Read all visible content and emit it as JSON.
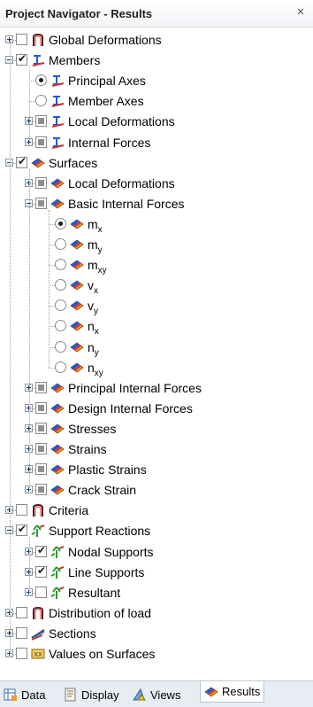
{
  "window": {
    "title": "Project Navigator - Results",
    "close_glyph": "×"
  },
  "tree": [
    {
      "key": "global_deformations",
      "label": "Global Deformations",
      "icon": "deformation-icon",
      "state": "unchecked",
      "expander": "plus"
    },
    {
      "key": "members",
      "label": "Members",
      "icon": "member-icon",
      "state": "checked",
      "expander": "minus"
    },
    {
      "key": "principal_axes",
      "label": "Principal Axes",
      "icon": "member-icon",
      "state": "radio-on"
    },
    {
      "key": "member_axes",
      "label": "Member Axes",
      "icon": "member-icon",
      "state": "radio-off"
    },
    {
      "key": "member_local_deformations",
      "label": "Local Deformations",
      "icon": "member-icon",
      "state": "partial",
      "expander": "plus"
    },
    {
      "key": "internal_forces",
      "label": "Internal Forces",
      "icon": "member-icon",
      "state": "partial",
      "expander": "plus"
    },
    {
      "key": "surfaces",
      "label": "Surfaces",
      "icon": "surface-icon",
      "state": "checked",
      "expander": "minus"
    },
    {
      "key": "surface_local_deformations",
      "label": "Local Deformations",
      "icon": "surface-icon",
      "state": "partial",
      "expander": "plus"
    },
    {
      "key": "basic_internal_forces",
      "label": "Basic Internal Forces",
      "icon": "surface-icon",
      "state": "partial",
      "expander": "minus"
    },
    {
      "key": "mx",
      "label": "m",
      "sub": "x",
      "icon": "surface-icon",
      "state": "radio-on"
    },
    {
      "key": "my",
      "label": "m",
      "sub": "y",
      "icon": "surface-icon",
      "state": "radio-off"
    },
    {
      "key": "mxy",
      "label": "m",
      "sub": "xy",
      "icon": "surface-icon",
      "state": "radio-off"
    },
    {
      "key": "vx",
      "label": "v",
      "sub": "x",
      "icon": "surface-icon",
      "state": "radio-off"
    },
    {
      "key": "vy",
      "label": "v",
      "sub": "y",
      "icon": "surface-icon",
      "state": "radio-off"
    },
    {
      "key": "nx",
      "label": "n",
      "sub": "x",
      "icon": "surface-icon",
      "state": "radio-off"
    },
    {
      "key": "ny",
      "label": "n",
      "sub": "y",
      "icon": "surface-icon",
      "state": "radio-off"
    },
    {
      "key": "nxy",
      "label": "n",
      "sub": "xy",
      "icon": "surface-icon",
      "state": "radio-off"
    },
    {
      "key": "principal_internal_forces",
      "label": "Principal Internal Forces",
      "icon": "surface-icon",
      "state": "partial",
      "expander": "plus"
    },
    {
      "key": "design_internal_forces",
      "label": "Design Internal Forces",
      "icon": "surface-icon",
      "state": "partial",
      "expander": "plus"
    },
    {
      "key": "stresses",
      "label": "Stresses",
      "icon": "surface-icon",
      "state": "partial",
      "expander": "plus"
    },
    {
      "key": "strains",
      "label": "Strains",
      "icon": "surface-icon",
      "state": "partial",
      "expander": "plus"
    },
    {
      "key": "plastic_strains",
      "label": "Plastic Strains",
      "icon": "surface-icon",
      "state": "partial",
      "expander": "plus"
    },
    {
      "key": "crack_strain",
      "label": "Crack Strain",
      "icon": "surface-icon",
      "state": "partial",
      "expander": "plus"
    },
    {
      "key": "criteria",
      "label": "Criteria",
      "icon": "deformation-icon",
      "state": "unchecked",
      "expander": "plus"
    },
    {
      "key": "support_reactions",
      "label": "Support Reactions",
      "icon": "support-icon",
      "state": "checked",
      "expander": "minus"
    },
    {
      "key": "nodal_supports",
      "label": "Nodal Supports",
      "icon": "support-icon",
      "state": "checked",
      "expander": "plus"
    },
    {
      "key": "line_supports",
      "label": "Line Supports",
      "icon": "support-icon",
      "state": "checked",
      "expander": "plus"
    },
    {
      "key": "resultant",
      "label": "Resultant",
      "icon": "support-icon",
      "state": "unchecked",
      "expander": "plus"
    },
    {
      "key": "distribution_of_load",
      "label": "Distribution of load",
      "icon": "deformation-icon",
      "state": "unchecked",
      "expander": "plus"
    },
    {
      "key": "sections",
      "label": "Sections",
      "icon": "section-icon",
      "state": "unchecked",
      "expander": "plus"
    },
    {
      "key": "values_on_surfaces",
      "label": "Values on Surfaces",
      "icon": "values-icon",
      "state": "unchecked",
      "expander": "plus"
    }
  ],
  "tabs": [
    {
      "key": "data",
      "label": "Data",
      "icon": "data-icon"
    },
    {
      "key": "display",
      "label": "Display",
      "icon": "display-icon"
    },
    {
      "key": "views",
      "label": "Views",
      "icon": "views-icon"
    },
    {
      "key": "results",
      "label": "Results",
      "icon": "surface-icon",
      "active": true
    }
  ],
  "colors": {
    "accent_blue": "#1e5bd6",
    "surface_orange": "#f0a020",
    "support_green": "#2f9a2f",
    "member_red": "#d03030"
  }
}
